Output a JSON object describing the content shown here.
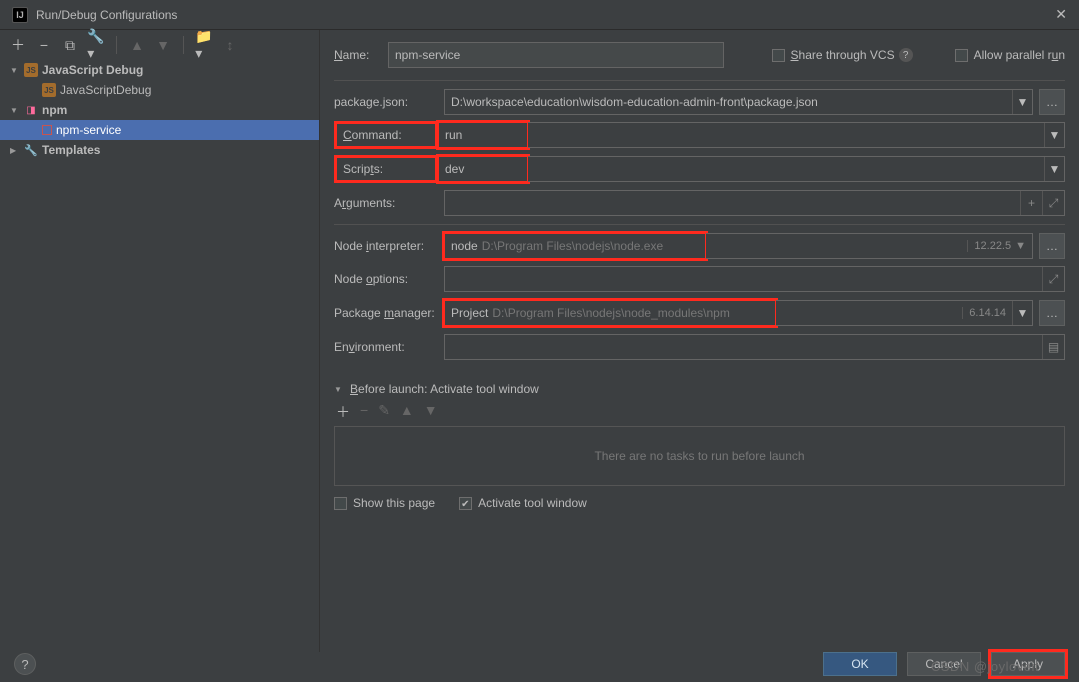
{
  "title": "Run/Debug Configurations",
  "share_vcs_label": "Share through VCS",
  "allow_parallel_label": "Allow parallel run",
  "name_label": "Name:",
  "name_value": "npm-service",
  "tree": {
    "js_debug": "JavaScript Debug",
    "js_debug_child": "JavaScriptDebug",
    "npm": "npm",
    "npm_service": "npm-service",
    "templates": "Templates"
  },
  "labels": {
    "package_json": "package.json:",
    "command": "Command:",
    "scripts": "Scripts:",
    "arguments": "Arguments:",
    "node_interpreter": "Node interpreter:",
    "node_options": "Node options:",
    "package_manager": "Package manager:",
    "environment": "Environment:"
  },
  "values": {
    "package_json": "D:\\workspace\\education\\wisdom-education-admin-front\\package.json",
    "command": "run",
    "scripts": "dev",
    "arguments": "",
    "node_word": "node",
    "node_path": "D:\\Program Files\\nodejs\\node.exe",
    "node_version": "12.22.5",
    "node_options": "",
    "pkg_word": "Project",
    "pkg_path": "D:\\Program Files\\nodejs\\node_modules\\npm",
    "pkg_version": "6.14.14",
    "environment": ""
  },
  "before": {
    "title": "Before launch: Activate tool window",
    "empty": "There are no tasks to run before launch",
    "show_page": "Show this page",
    "activate": "Activate tool window"
  },
  "buttons": {
    "ok": "OK",
    "cancel": "Cancel",
    "apply": "Apply"
  },
  "watermark": "CSDN @joyloveit"
}
